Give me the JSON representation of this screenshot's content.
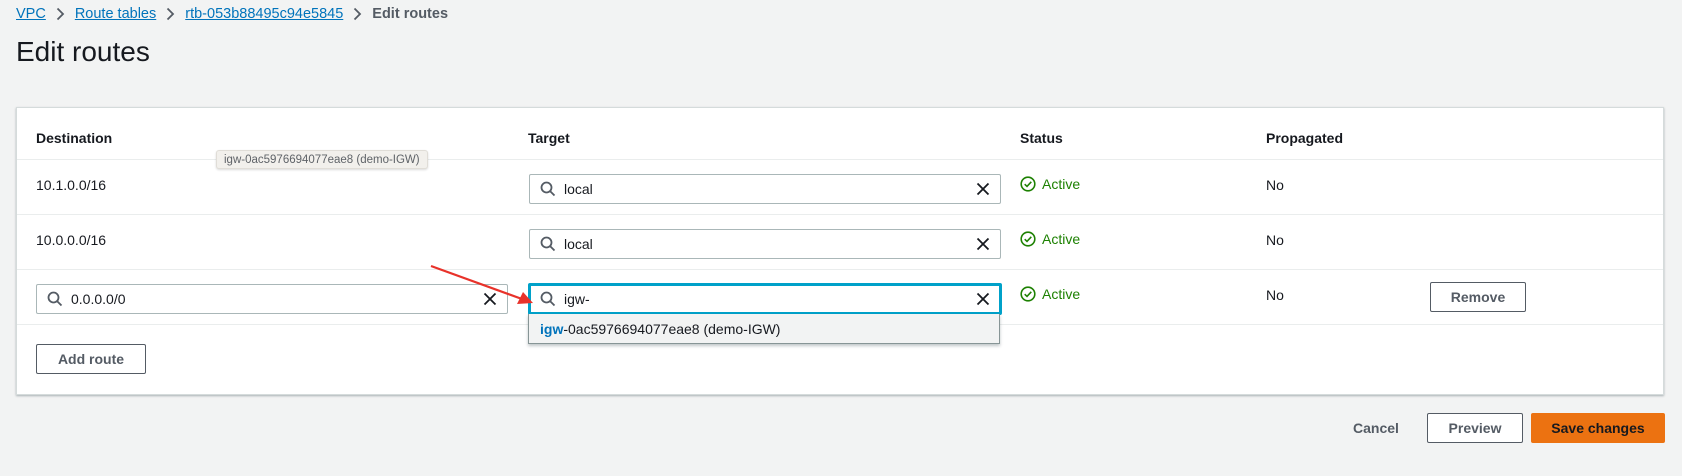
{
  "breadcrumb": {
    "vpc": "VPC",
    "route_tables": "Route tables",
    "route_table_id": "rtb-053b88495c94e5845",
    "current": "Edit routes"
  },
  "page": {
    "title": "Edit routes"
  },
  "table": {
    "headers": {
      "destination": "Destination",
      "target": "Target",
      "status": "Status",
      "propagated": "Propagated"
    },
    "rows": [
      {
        "destination": "10.1.0.0/16",
        "target": "local",
        "status": "Active",
        "propagated": "No"
      },
      {
        "destination": "10.0.0.0/16",
        "target": "local",
        "status": "Active",
        "propagated": "No"
      },
      {
        "destination": "0.0.0.0/0",
        "target": "igw-",
        "status": "Active",
        "propagated": "No",
        "remove_label": "Remove"
      }
    ]
  },
  "tooltip": {
    "text": "igw-0ac5976694077eae8 (demo-IGW)"
  },
  "dropdown": {
    "option_match": "igw",
    "option_rest": "-0ac5976694077eae8 (demo-IGW)"
  },
  "buttons": {
    "add_route": "Add route",
    "cancel": "Cancel",
    "preview": "Preview",
    "save": "Save changes"
  },
  "colors": {
    "link": "#0073bb",
    "active_status": "#1d8102",
    "primary_button": "#ec7211",
    "focus_border": "#00a1c9",
    "annotation_arrow": "#e8322a"
  },
  "icons": [
    "chevron-right-icon",
    "search-icon",
    "close-icon",
    "check-circle-icon",
    "arrow-annotation"
  ]
}
